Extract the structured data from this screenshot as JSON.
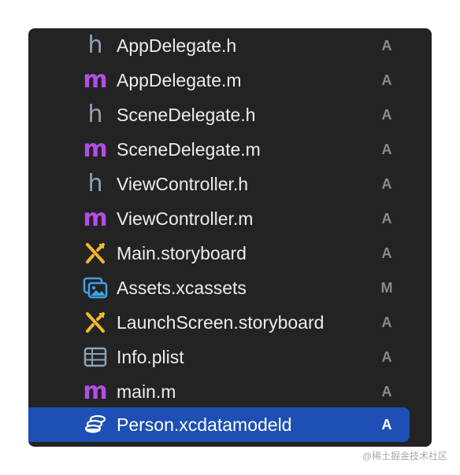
{
  "files": [
    {
      "name": "AppDelegate.h",
      "status": "A",
      "icon": "header-file-icon",
      "glyph": "h"
    },
    {
      "name": "AppDelegate.m",
      "status": "A",
      "icon": "objc-source-file-icon",
      "glyph": "m"
    },
    {
      "name": "SceneDelegate.h",
      "status": "A",
      "icon": "header-file-icon",
      "glyph": "h"
    },
    {
      "name": "SceneDelegate.m",
      "status": "A",
      "icon": "objc-source-file-icon",
      "glyph": "m"
    },
    {
      "name": "ViewController.h",
      "status": "A",
      "icon": "header-file-icon",
      "glyph": "h"
    },
    {
      "name": "ViewController.m",
      "status": "A",
      "icon": "objc-source-file-icon",
      "glyph": "m"
    },
    {
      "name": "Main.storyboard",
      "status": "A",
      "icon": "storyboard-icon"
    },
    {
      "name": "Assets.xcassets",
      "status": "M",
      "icon": "asset-catalog-icon"
    },
    {
      "name": "LaunchScreen.storyboard",
      "status": "A",
      "icon": "storyboard-icon"
    },
    {
      "name": "Info.plist",
      "status": "A",
      "icon": "plist-icon"
    },
    {
      "name": "main.m",
      "status": "A",
      "icon": "objc-source-file-icon",
      "glyph": "m"
    },
    {
      "name": "Person.xcdatamodeld",
      "status": "A",
      "icon": "core-data-model-icon",
      "selected": true
    }
  ],
  "colors": {
    "panel_background": "#232323",
    "selection": "#1d4fb4",
    "header_icon": "#8fa2b4",
    "source_icon": "#b14ee6",
    "storyboard_icon": "#f5b82e",
    "asset_icon": "#3fa2e8",
    "status_text": "#8a8a8a"
  },
  "watermark": "@稀土掘金技术社区"
}
